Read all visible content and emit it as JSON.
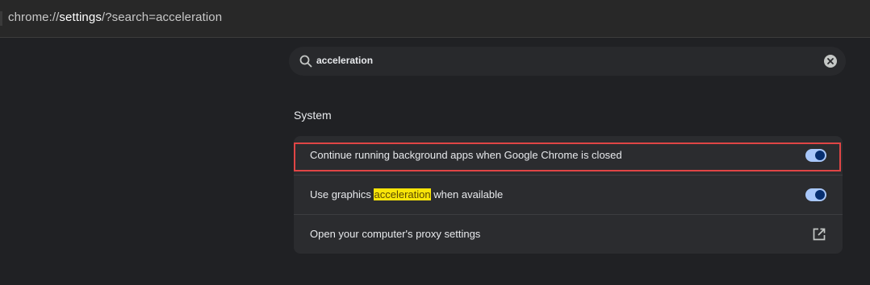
{
  "address_bar": {
    "url_prefix": "chrome://",
    "url_host": "settings",
    "url_suffix": "/?search=acceleration"
  },
  "search": {
    "value": "acceleration",
    "search_icon": "search-icon",
    "clear_icon": "clear-circle-icon"
  },
  "section": {
    "title": "System",
    "rows": [
      {
        "label": "Continue running background apps when Google Chrome is closed",
        "control": "toggle",
        "checked": true
      },
      {
        "label_before": "Use graphics ",
        "label_highlight": "acceleration",
        "label_after": " when available",
        "control": "toggle",
        "checked": true,
        "annotated": true
      },
      {
        "label": "Open your computer's proxy settings",
        "control": "open-in-new-icon"
      }
    ]
  },
  "colors": {
    "toggle_track": "#a8c7fa",
    "toggle_knob": "#062e6f",
    "search_highlight": "#f9e509",
    "annotation_border": "#e04545"
  }
}
